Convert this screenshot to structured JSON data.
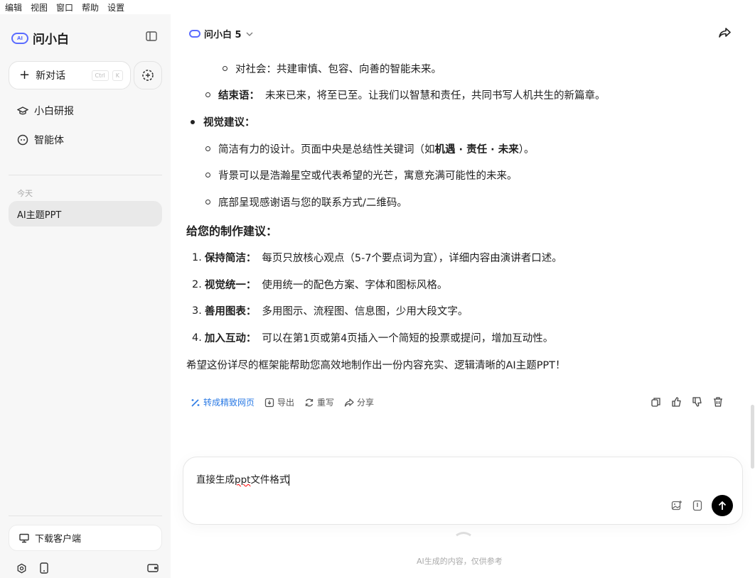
{
  "menu": [
    "编辑",
    "视图",
    "窗口",
    "帮助",
    "设置"
  ],
  "sidebar": {
    "app_name": "问小白",
    "logo_badge": "AI",
    "new_chat": "新对话",
    "kbd_ctrl": "Ctrl",
    "kbd_k": "K",
    "nav": [
      {
        "label": "小白研报",
        "icon": "graduation-cap-icon"
      },
      {
        "label": "智能体",
        "icon": "robot-icon"
      }
    ],
    "section_today": "今天",
    "history": [
      "AI主题PPT"
    ],
    "download": "下载客户端"
  },
  "header": {
    "model": "问小白 5"
  },
  "message": {
    "l1": "对社会：共建审慎、包容、向善的智能未来。",
    "l2_label": "结束语：",
    "l2_text": "未来已来，将至已至。让我们以智慧和责任，共同书写人机共生的新篇章。",
    "l3": "视觉建议：",
    "l4_a": "简洁有力的设计。页面中央是总结性关键词（如 ",
    "l4_b": "机遇 · 责任 · 未来",
    "l4_c": "）。",
    "l5": "背景可以是浩瀚星空或代表希望的光芒，寓意充满可能性的未来。",
    "l6": "底部呈现感谢语与您的联系方式/二维码。",
    "heading": "给您的制作建议：",
    "tips": [
      {
        "n": "1.",
        "label": "保持简洁：",
        "text": "每页只放核心观点（5-7个要点词为宜），详细内容由演讲者口述。"
      },
      {
        "n": "2.",
        "label": "视觉统一：",
        "text": "使用统一的配色方案、字体和图标风格。"
      },
      {
        "n": "3.",
        "label": "善用图表：",
        "text": "多用图示、流程图、信息图，少用大段文字。"
      },
      {
        "n": "4.",
        "label": "加入互动：",
        "text": "可以在第1页或第4页插入一个简短的投票或提问，增加互动性。"
      }
    ],
    "closing": "希望这份详尽的框架能帮助您高效地制作出一份内容充实、逻辑清晰的AI主题PPT！"
  },
  "actions": {
    "webpage": "转成精致网页",
    "export": "导出",
    "rewrite": "重写",
    "share": "分享"
  },
  "input": {
    "pre": "直接生成",
    "misspelled": "ppt",
    "post": "文件格式"
  },
  "footer": "AI生成的内容，仅供参考",
  "colors": {
    "accent": "#2c7be5",
    "brand": "#5b6cff"
  }
}
